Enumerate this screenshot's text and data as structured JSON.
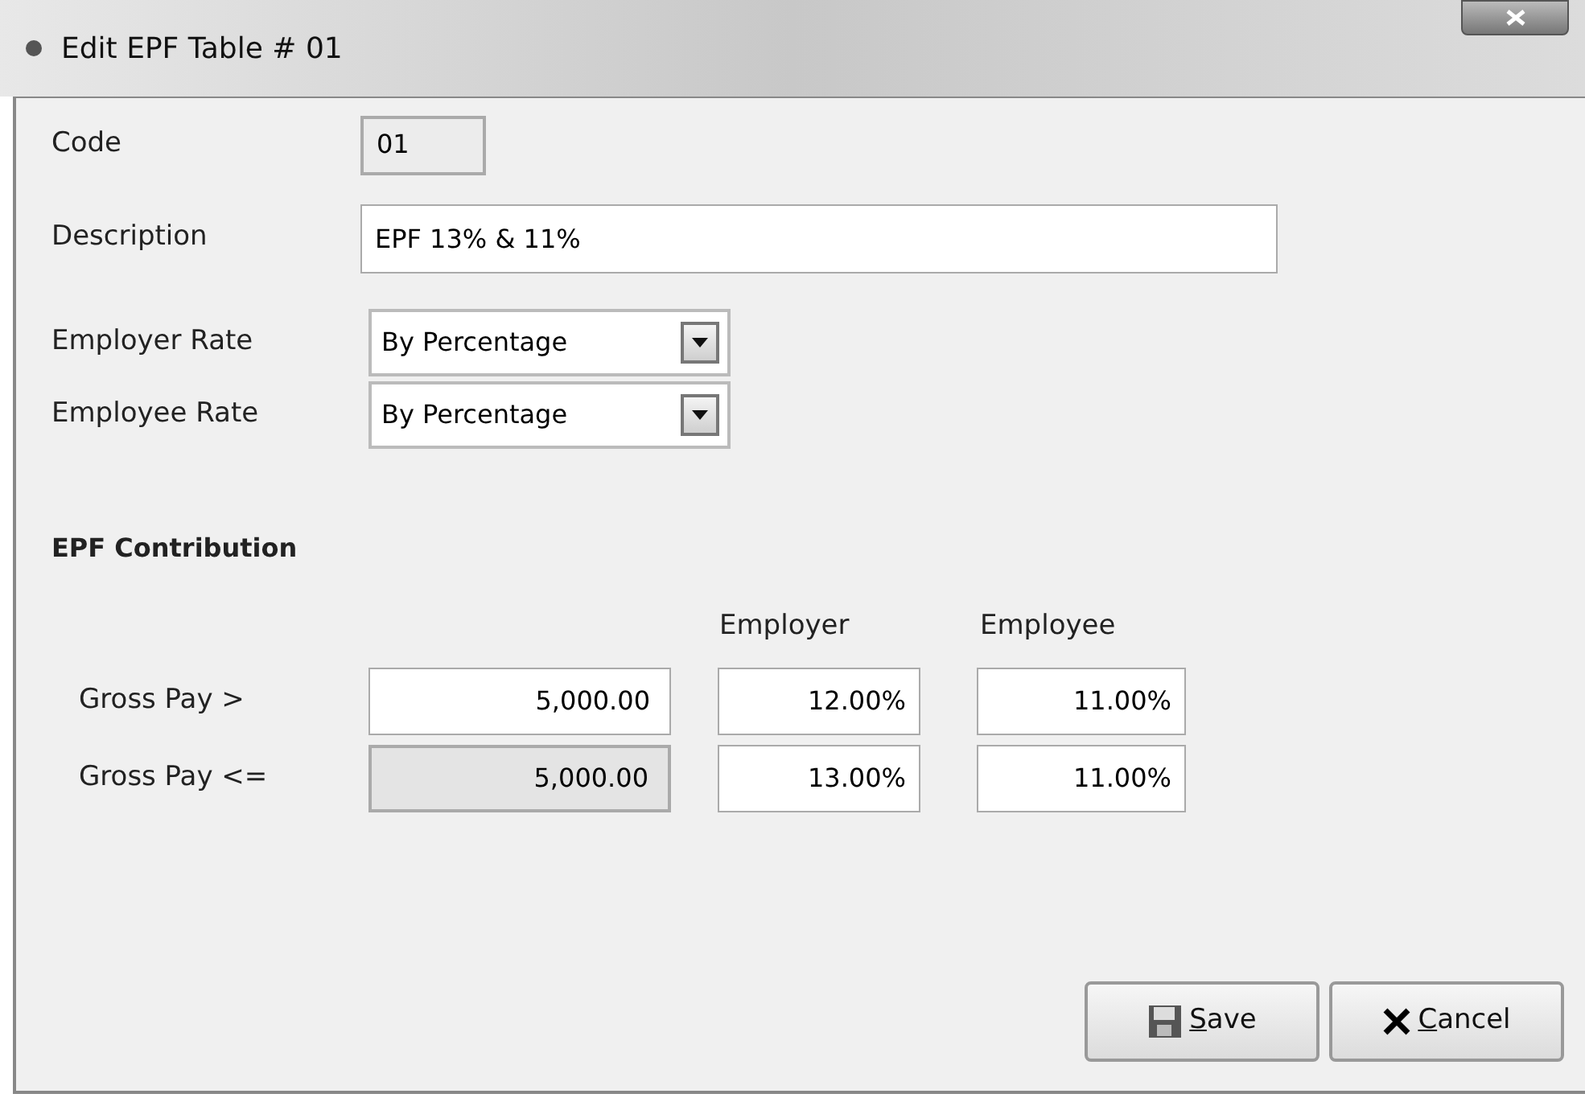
{
  "window": {
    "title": "Edit EPF Table # 01"
  },
  "code": {
    "label": "Code",
    "value": "01"
  },
  "description": {
    "label": "Description",
    "value": "EPF 13% & 11%"
  },
  "rates": [
    {
      "label": "Employer Rate",
      "value": "By Percentage"
    },
    {
      "label": "Employee Rate",
      "value": "By Percentage"
    }
  ],
  "contribution": {
    "heading": "EPF Contribution",
    "columns": [
      "Employer",
      "Employee"
    ],
    "rows": [
      {
        "label": "Gross Pay >",
        "amount": "5,000.00",
        "disabled": false,
        "employer": "12.00%",
        "employee": "11.00%"
      },
      {
        "label": "Gross Pay <=",
        "amount": "5,000.00",
        "disabled": true,
        "employer": "13.00%",
        "employee": "11.00%"
      }
    ]
  },
  "buttons": [
    {
      "kind": "save",
      "label": "Save"
    },
    {
      "kind": "cancel",
      "label": "Cancel"
    }
  ]
}
